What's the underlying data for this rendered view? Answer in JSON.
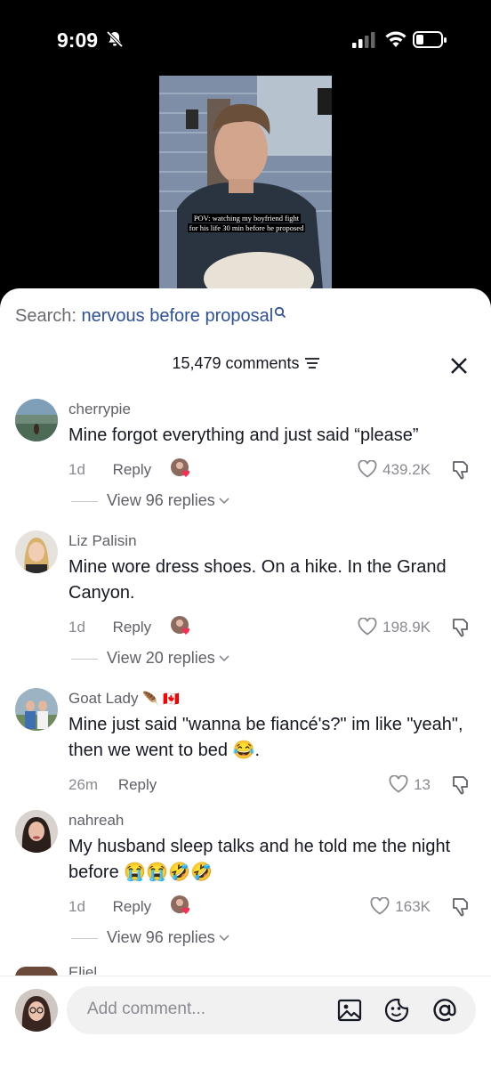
{
  "status_bar": {
    "time": "9:09"
  },
  "video": {
    "caption_line1": "POV: watching my boyfriend fight",
    "caption_line2": "for his life 30 min before he proposed"
  },
  "search": {
    "label": "Search:",
    "query": "nervous before proposal"
  },
  "comments_header": {
    "count_label": "15,479 comments"
  },
  "comments": [
    {
      "username": "cherrypie",
      "text": "Mine forgot everything and just said “please”",
      "time": "1d",
      "reply_label": "Reply",
      "likes": "439.2K",
      "view_replies": "View 96 replies"
    },
    {
      "username": "Liz Palisin",
      "text": "Mine wore dress shoes. On a hike. In the Grand Canyon.",
      "time": "1d",
      "reply_label": "Reply",
      "likes": "198.9K",
      "view_replies": "View 20 replies"
    },
    {
      "username": "Goat Lady",
      "username_emoji": "🪶 🇨🇦",
      "text": "Mine just said \"wanna be fiancé's?\" im like \"yeah\", then we went to bed",
      "text_emoji": "😂.",
      "time": "26m",
      "reply_label": "Reply",
      "likes": "13"
    },
    {
      "username": "nahreah",
      "text": "My husband sleep talks and he told me the night before",
      "text_emoji": "😭😭🤣🤣",
      "time": "1d",
      "reply_label": "Reply",
      "likes": "163K",
      "view_replies": "View 96 replies"
    }
  ],
  "next_username_partial": "Eliel",
  "composer": {
    "placeholder": "Add comment..."
  },
  "icons": [
    "bell-slash-icon",
    "signal-icon",
    "wifi-icon",
    "battery-icon",
    "search-icon",
    "filter-icon",
    "close-icon",
    "heart-icon",
    "dislike-icon",
    "chevron-down-icon",
    "image-icon",
    "sticker-icon",
    "mention-icon"
  ],
  "colors": {
    "search_query": "#2e4f9a",
    "text": "#161823",
    "muted": "#8a8b91"
  }
}
